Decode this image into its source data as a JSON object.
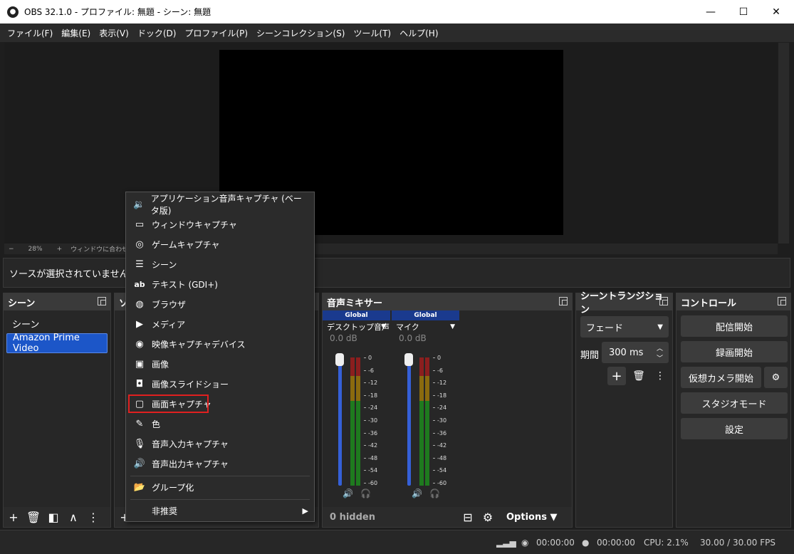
{
  "window": {
    "title": "OBS 32.1.0 - プロファイル: 無題 - シーン: 無題",
    "minimize": "—",
    "maximize": "☐",
    "close": "✕"
  },
  "menu": [
    "ファイル(F)",
    "編集(E)",
    "表示(V)",
    "ドック(D)",
    "プロファイル(P)",
    "シーンコレクション(S)",
    "ツール(T)",
    "ヘルプ(H)"
  ],
  "zoom": {
    "minus": "−",
    "value": "28%",
    "plus": "+",
    "fit": "ウィンドウに合わせて拡大"
  },
  "source_info": "ソースが選択されていません",
  "scenes": {
    "title": "シーン",
    "items": [
      "シーン",
      "Amazon Prime Video"
    ]
  },
  "sources": {
    "title": "ソース"
  },
  "mixer": {
    "title": "音声ミキサー",
    "strips": [
      {
        "header": "Global",
        "name": "デスクトップ音声",
        "db": "0.0 dB"
      },
      {
        "header": "Global",
        "name": "マイク",
        "db": "0.0 dB"
      }
    ],
    "ticks": [
      "0",
      "-6",
      "-12",
      "-18",
      "-24",
      "-30",
      "-36",
      "-42",
      "-48",
      "-54",
      "-60"
    ],
    "hidden": "0 hidden",
    "options": "Options"
  },
  "transitions": {
    "title": "シーントランジション",
    "selected": "フェード",
    "duration_label": "期間",
    "duration": "300 ms"
  },
  "controls": {
    "title": "コントロール",
    "buttons": [
      "配信開始",
      "録画開始",
      "仮想カメラ開始",
      "スタジオモード",
      "設定"
    ]
  },
  "context_menu": {
    "items": [
      {
        "label": "アプリケーション音声キャプチャ (ベータ版)",
        "icon": "app-audio-icon"
      },
      {
        "label": "ウィンドウキャプチャ",
        "icon": "window-icon"
      },
      {
        "label": "ゲームキャプチャ",
        "icon": "gamepad-icon"
      },
      {
        "label": "シーン",
        "icon": "list-icon"
      },
      {
        "label": "テキスト (GDI+)",
        "icon": "text-icon"
      },
      {
        "label": "ブラウザ",
        "icon": "globe-icon"
      },
      {
        "label": "メディア",
        "icon": "play-icon"
      },
      {
        "label": "映像キャプチャデバイス",
        "icon": "camera-icon"
      },
      {
        "label": "画像",
        "icon": "image-icon"
      },
      {
        "label": "画像スライドショー",
        "icon": "slideshow-icon"
      },
      {
        "label": "画面キャプチャ",
        "icon": "monitor-icon"
      },
      {
        "label": "色",
        "icon": "brush-icon"
      },
      {
        "label": "音声入力キャプチャ",
        "icon": "mic-icon"
      },
      {
        "label": "音声出力キャプチャ",
        "icon": "speaker-icon"
      }
    ],
    "group": "グループ化",
    "deprecated": "非推奨",
    "highlight_color": "#e02020"
  },
  "status": {
    "rec_time": "00:00:00",
    "stream_time": "00:00:00",
    "cpu": "CPU: 2.1%",
    "fps": "30.00 / 30.00 FPS"
  },
  "colors": {
    "accent": "#1c56c8",
    "background": "#1e1e1e",
    "panel": "#272727"
  }
}
